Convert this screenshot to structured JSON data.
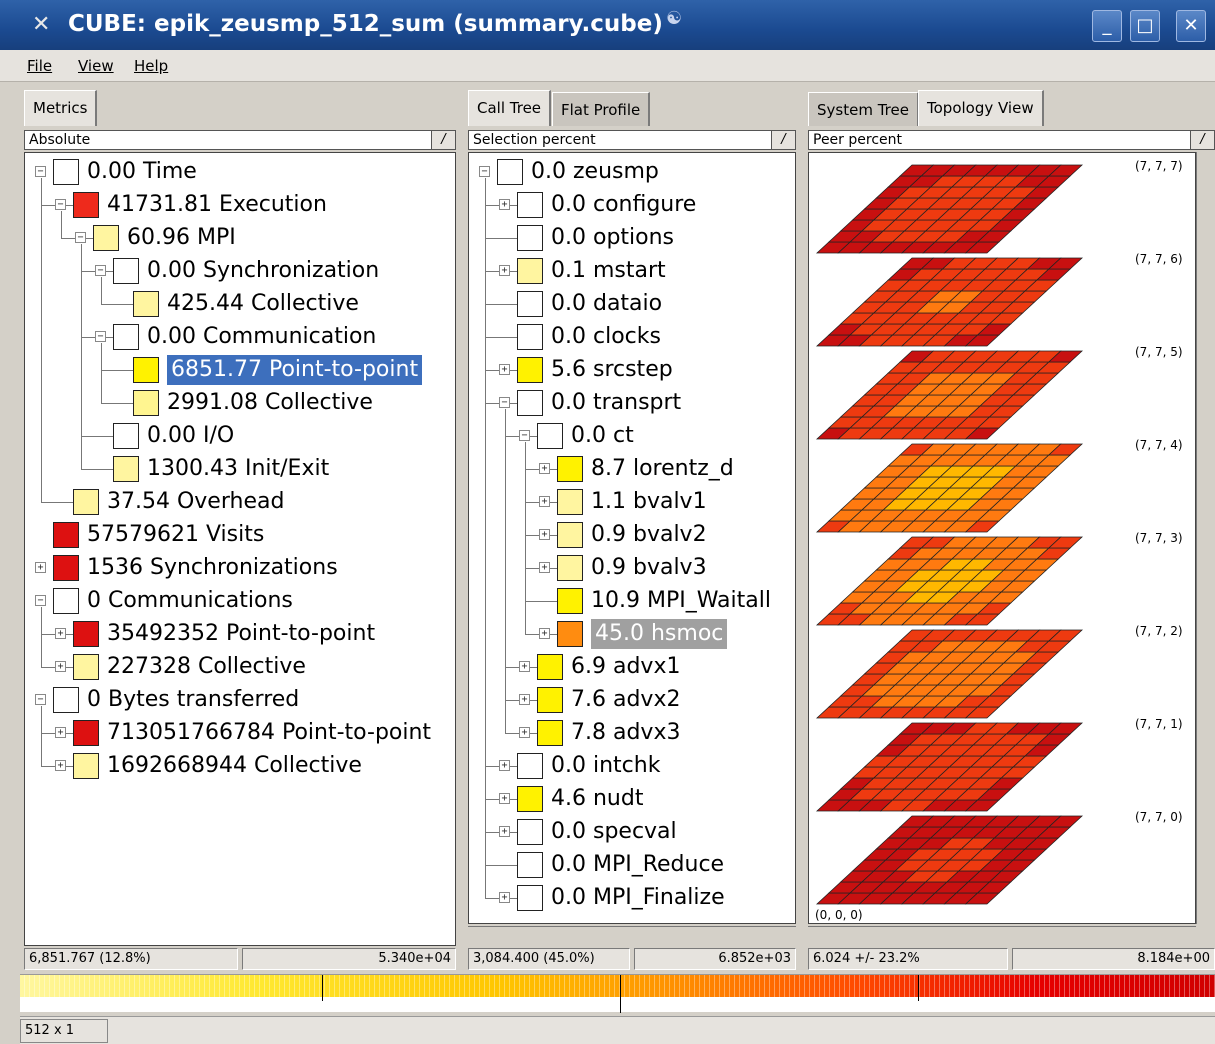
{
  "window": {
    "title": "CUBE: epik_zeusmp_512_sum (summary.cube)",
    "minimize": "_",
    "maximize": "□",
    "close": "✕"
  },
  "menu": [
    "File",
    "View",
    "Help"
  ],
  "metrics_panel": {
    "tab": "Metrics",
    "mode": "Absolute",
    "items": [
      {
        "value": "0.00",
        "label": "Time",
        "color": "#ffffff"
      },
      {
        "value": "41731.81",
        "label": "Execution",
        "color": "#ee2a1c"
      },
      {
        "value": "60.96",
        "label": "MPI",
        "color": "#fff5a0"
      },
      {
        "value": "0.00",
        "label": "Synchronization",
        "color": "#ffffff"
      },
      {
        "value": "425.44",
        "label": "Collective",
        "color": "#fff5a0"
      },
      {
        "value": "0.00",
        "label": "Communication",
        "color": "#ffffff"
      },
      {
        "value": "6851.77",
        "label": "Point-to-point",
        "color": "#fff200"
      },
      {
        "value": "2991.08",
        "label": "Collective",
        "color": "#fff590"
      },
      {
        "value": "0.00",
        "label": "I/O",
        "color": "#ffffff"
      },
      {
        "value": "1300.43",
        "label": "Init/Exit",
        "color": "#fff5a0"
      },
      {
        "value": "37.54",
        "label": "Overhead",
        "color": "#fff5a0"
      },
      {
        "value": "57579621",
        "label": "Visits",
        "color": "#dd1111"
      },
      {
        "value": "1536",
        "label": "Synchronizations",
        "color": "#dd1111"
      },
      {
        "value": "0",
        "label": "Communications",
        "color": "#ffffff"
      },
      {
        "value": "35492352",
        "label": "Point-to-point",
        "color": "#dd1111"
      },
      {
        "value": "227328",
        "label": "Collective",
        "color": "#fff5a0"
      },
      {
        "value": "0",
        "label": "Bytes transferred",
        "color": "#ffffff"
      },
      {
        "value": "713051766784",
        "label": "Point-to-point",
        "color": "#dd1111"
      },
      {
        "value": "1692668944",
        "label": "Collective",
        "color": "#fff5a0"
      }
    ],
    "status_left": "6,851.767  (12.8%)",
    "status_right": "5.340e+04"
  },
  "calltree_panel": {
    "tabs": [
      "Call Tree",
      "Flat Profile"
    ],
    "mode": "Selection percent",
    "items": [
      {
        "value": "0.0",
        "label": "zeusmp",
        "color": "#ffffff"
      },
      {
        "value": "0.0",
        "label": "configure",
        "color": "#ffffff"
      },
      {
        "value": "0.0",
        "label": "options",
        "color": "#ffffff"
      },
      {
        "value": "0.1",
        "label": "mstart",
        "color": "#fff5a0"
      },
      {
        "value": "0.0",
        "label": "dataio",
        "color": "#ffffff"
      },
      {
        "value": "0.0",
        "label": "clocks",
        "color": "#ffffff"
      },
      {
        "value": "5.6",
        "label": "srcstep",
        "color": "#fff200"
      },
      {
        "value": "0.0",
        "label": "transprt",
        "color": "#ffffff"
      },
      {
        "value": "0.0",
        "label": "ct",
        "color": "#ffffff"
      },
      {
        "value": "8.7",
        "label": "lorentz_d",
        "color": "#fff200"
      },
      {
        "value": "1.1",
        "label": "bvalv1",
        "color": "#fff5a0"
      },
      {
        "value": "0.9",
        "label": "bvalv2",
        "color": "#fff5a0"
      },
      {
        "value": "0.9",
        "label": "bvalv3",
        "color": "#fff5a0"
      },
      {
        "value": "10.9",
        "label": "MPI_Waitall",
        "color": "#fff200"
      },
      {
        "value": "45.0",
        "label": "hsmoc",
        "color": "#ff8c10"
      },
      {
        "value": "6.9",
        "label": "advx1",
        "color": "#fff200"
      },
      {
        "value": "7.6",
        "label": "advx2",
        "color": "#fff200"
      },
      {
        "value": "7.8",
        "label": "advx3",
        "color": "#fff200"
      },
      {
        "value": "0.0",
        "label": "intchk",
        "color": "#ffffff"
      },
      {
        "value": "4.6",
        "label": "nudt",
        "color": "#fff200"
      },
      {
        "value": "0.0",
        "label": "specval",
        "color": "#ffffff"
      },
      {
        "value": "0.0",
        "label": "MPI_Reduce",
        "color": "#ffffff"
      },
      {
        "value": "0.0",
        "label": "MPI_Finalize",
        "color": "#ffffff"
      }
    ],
    "status_left": "3,084.400  (45.0%)",
    "status_right": "6.852e+03"
  },
  "system_panel": {
    "tabs": [
      "System Tree",
      "Topology View"
    ],
    "mode": "Peer percent",
    "planes": [
      "(7, 7, 7)",
      "(7, 7, 6)",
      "(7, 7, 5)",
      "(7, 7, 4)",
      "(7, 7, 3)",
      "(7, 7, 2)",
      "(7, 7, 1)",
      "(7, 7, 0)"
    ],
    "origin": "(0, 0, 0)",
    "status_left": "6.024 +/- 23.2%",
    "status_right": "8.184e+00"
  },
  "colors": {
    "selection": "#3d6fbd",
    "highlight": "#a0a0a0",
    "grid_dark": "#c81010",
    "grid_mid": "#ee3a10",
    "grid_hot": "#ffb800"
  },
  "bottom_status": "512 x 1"
}
